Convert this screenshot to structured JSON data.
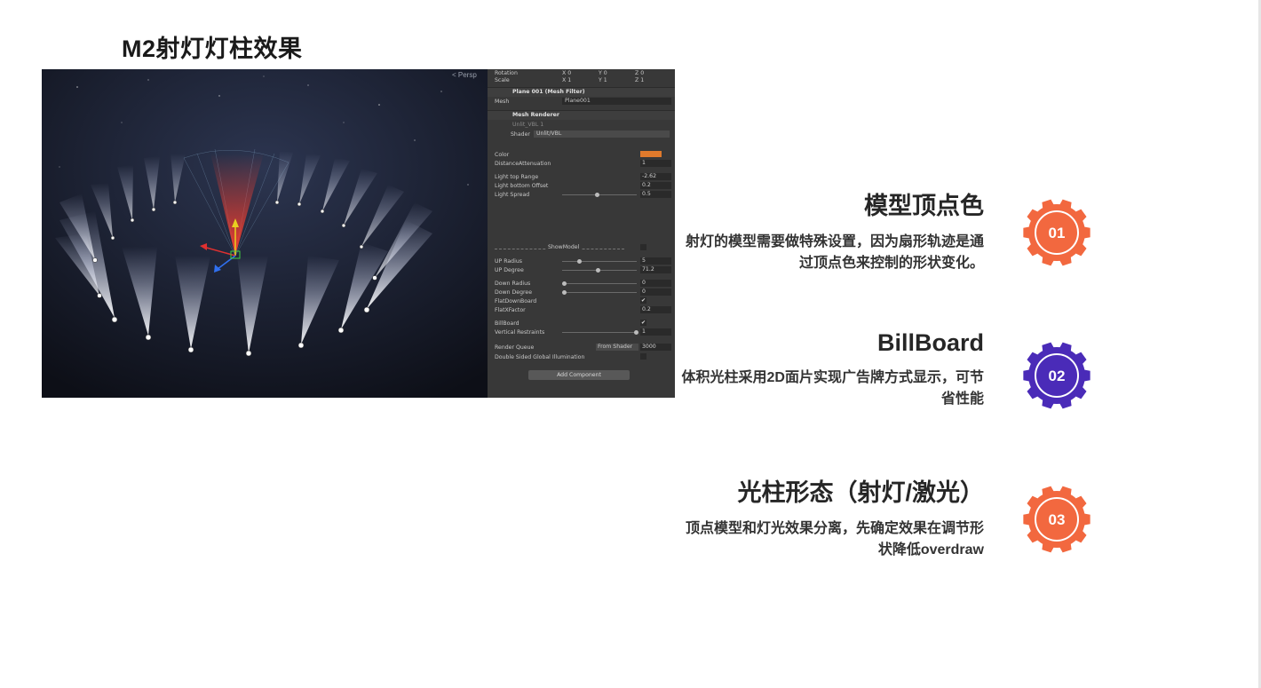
{
  "title": "M2射灯灯柱效果",
  "scene": {
    "persp_label": "< Persp"
  },
  "inspector": {
    "rotation_label": "Rotation",
    "rotation_values": [
      "X 0",
      "Y 0",
      "Z 0"
    ],
    "scale_label": "Scale",
    "scale_values": [
      "X 1",
      "Y 1",
      "Z 1"
    ],
    "mesh_filter_header": "Plane 001 (Mesh Filter)",
    "mesh_label": "Mesh",
    "mesh_value": "Plane001",
    "mesh_renderer_header": "Mesh Renderer",
    "material_name": "Unlit_VBL 1",
    "shader_label": "Shader",
    "shader_value": "Unlit/VBL",
    "color_label": "Color",
    "distance_attenuation_label": "DistanceAttenuation",
    "distance_attenuation_value": "1",
    "light_top_range_label": "Light top Range",
    "light_top_range_value": "-2.62",
    "light_bottom_offset_label": "Light bottom Offset",
    "light_bottom_offset_value": "0.2",
    "light_spread_label": "Light Spread",
    "light_spread_value": "0.5",
    "show_model_label": "ShowModel",
    "up_radius_label": "UP Radius",
    "up_radius_value": "5",
    "up_degree_label": "UP Degree",
    "up_degree_value": "71.2",
    "down_radius_label": "Down Radius",
    "down_radius_value": "0",
    "down_degree_label": "Down Degree",
    "down_degree_value": "0",
    "flat_down_board_label": "FlatDownBoard",
    "flat_x_factor_label": "FlatXFactor",
    "flat_x_factor_value": "0.2",
    "billboard_label": "BillBoard",
    "vertical_restraints_label": "Vertical Restraints",
    "vertical_restraints_value": "1",
    "render_queue_label": "Render Queue",
    "render_queue_mode": "From Shader",
    "render_queue_value": "3000",
    "double_sided_gi_label": "Double Sided Global Illumination",
    "add_component_label": "Add Component",
    "accent_color": "#e07a2c"
  },
  "features": [
    {
      "number": "01",
      "title": "模型顶点色",
      "desc": "射灯的模型需要做特殊设置，因为扇形轨迹是通过顶点色来控制的形状变化。",
      "color": "#f2683f"
    },
    {
      "number": "02",
      "title": "BillBoard",
      "desc": "体积光柱采用2D面片实现广告牌方式显示，可节省性能",
      "color": "#4a2bb8"
    },
    {
      "number": "03",
      "title": "光柱形态（射灯/激光）",
      "desc": "顶点模型和灯光效果分离，先确定效果在调节形状降低overdraw",
      "color": "#f2683f"
    }
  ]
}
